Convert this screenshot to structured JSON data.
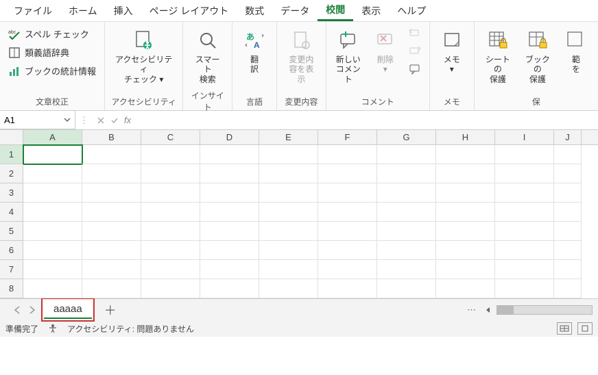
{
  "menu": {
    "items": [
      "ファイル",
      "ホーム",
      "挿入",
      "ページ レイアウト",
      "数式",
      "データ",
      "校閲",
      "表示",
      "ヘルプ"
    ],
    "active_index": 6
  },
  "ribbon": {
    "groups": [
      {
        "label": "文章校正",
        "items_small": [
          {
            "label": "スペル チェック",
            "icon": "abc-check"
          },
          {
            "label": "類義語辞典",
            "icon": "book"
          },
          {
            "label": "ブックの統計情報",
            "icon": "stats"
          }
        ]
      },
      {
        "label": "アクセシビリティ",
        "items_large": [
          {
            "label": "アクセシビリティ\nチェック ▾",
            "icon": "person-accessibility",
            "disabled": false
          }
        ]
      },
      {
        "label": "インサイト",
        "items_large": [
          {
            "label": "スマート\n検索",
            "icon": "magnify",
            "disabled": false
          }
        ]
      },
      {
        "label": "言語",
        "items_large": [
          {
            "label": "翻\n訳",
            "icon": "translate",
            "disabled": false
          }
        ]
      },
      {
        "label": "変更内容",
        "items_large": [
          {
            "label": "変更内\n容を表示",
            "icon": "page-changes",
            "disabled": true
          }
        ]
      },
      {
        "label": "コメント",
        "items_large": [
          {
            "label": "新しい\nコメント",
            "icon": "comment-add",
            "disabled": false
          },
          {
            "label": "削除\n▾",
            "icon": "comment-delete",
            "disabled": true
          }
        ],
        "items_small_icons": [
          {
            "icon": "comment-prev",
            "disabled": true
          },
          {
            "icon": "comment-next",
            "disabled": true
          },
          {
            "icon": "comment-show",
            "disabled": false
          }
        ]
      },
      {
        "label": "メモ",
        "items_large": [
          {
            "label": "メモ\n▾",
            "icon": "note",
            "disabled": false
          }
        ]
      },
      {
        "label": "保",
        "items_large": [
          {
            "label": "シートの\n保護",
            "icon": "sheet-lock",
            "disabled": false
          },
          {
            "label": "ブックの\n保護",
            "icon": "book-lock",
            "disabled": false
          },
          {
            "label": "範\nを",
            "icon": "range",
            "disabled": false
          }
        ]
      }
    ]
  },
  "formula_bar": {
    "name_box_value": "A1",
    "fx_label": "fx",
    "formula_value": ""
  },
  "grid": {
    "columns": [
      "A",
      "B",
      "C",
      "D",
      "E",
      "F",
      "G",
      "H",
      "I",
      "J"
    ],
    "rows": [
      1,
      2,
      3,
      4,
      5,
      6,
      7,
      8
    ],
    "active_cell": "A1"
  },
  "sheet_tabs": {
    "active": "aaaaa"
  },
  "status": {
    "ready": "準備完了",
    "accessibility": "アクセシビリティ: 問題ありません"
  }
}
